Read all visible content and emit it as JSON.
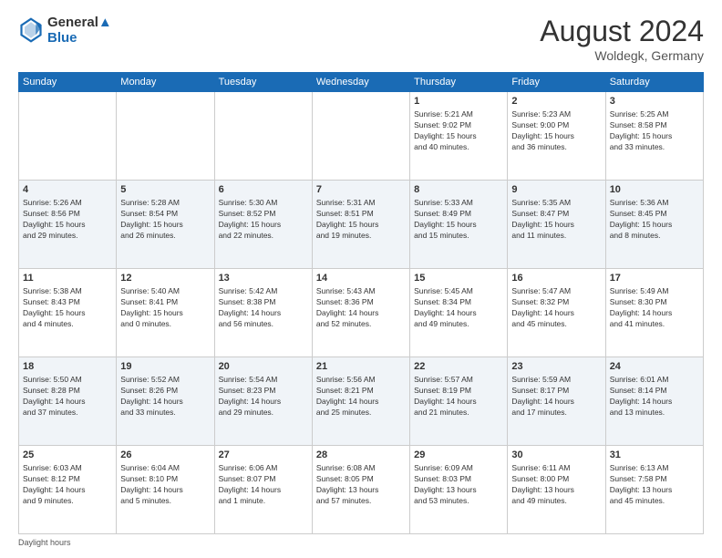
{
  "header": {
    "logo_line1": "General",
    "logo_line2": "Blue",
    "month_year": "August 2024",
    "location": "Woldegk, Germany"
  },
  "days_of_week": [
    "Sunday",
    "Monday",
    "Tuesday",
    "Wednesday",
    "Thursday",
    "Friday",
    "Saturday"
  ],
  "weeks": [
    [
      {
        "day": "",
        "info": ""
      },
      {
        "day": "",
        "info": ""
      },
      {
        "day": "",
        "info": ""
      },
      {
        "day": "",
        "info": ""
      },
      {
        "day": "1",
        "info": "Sunrise: 5:21 AM\nSunset: 9:02 PM\nDaylight: 15 hours\nand 40 minutes."
      },
      {
        "day": "2",
        "info": "Sunrise: 5:23 AM\nSunset: 9:00 PM\nDaylight: 15 hours\nand 36 minutes."
      },
      {
        "day": "3",
        "info": "Sunrise: 5:25 AM\nSunset: 8:58 PM\nDaylight: 15 hours\nand 33 minutes."
      }
    ],
    [
      {
        "day": "4",
        "info": "Sunrise: 5:26 AM\nSunset: 8:56 PM\nDaylight: 15 hours\nand 29 minutes."
      },
      {
        "day": "5",
        "info": "Sunrise: 5:28 AM\nSunset: 8:54 PM\nDaylight: 15 hours\nand 26 minutes."
      },
      {
        "day": "6",
        "info": "Sunrise: 5:30 AM\nSunset: 8:52 PM\nDaylight: 15 hours\nand 22 minutes."
      },
      {
        "day": "7",
        "info": "Sunrise: 5:31 AM\nSunset: 8:51 PM\nDaylight: 15 hours\nand 19 minutes."
      },
      {
        "day": "8",
        "info": "Sunrise: 5:33 AM\nSunset: 8:49 PM\nDaylight: 15 hours\nand 15 minutes."
      },
      {
        "day": "9",
        "info": "Sunrise: 5:35 AM\nSunset: 8:47 PM\nDaylight: 15 hours\nand 11 minutes."
      },
      {
        "day": "10",
        "info": "Sunrise: 5:36 AM\nSunset: 8:45 PM\nDaylight: 15 hours\nand 8 minutes."
      }
    ],
    [
      {
        "day": "11",
        "info": "Sunrise: 5:38 AM\nSunset: 8:43 PM\nDaylight: 15 hours\nand 4 minutes."
      },
      {
        "day": "12",
        "info": "Sunrise: 5:40 AM\nSunset: 8:41 PM\nDaylight: 15 hours\nand 0 minutes."
      },
      {
        "day": "13",
        "info": "Sunrise: 5:42 AM\nSunset: 8:38 PM\nDaylight: 14 hours\nand 56 minutes."
      },
      {
        "day": "14",
        "info": "Sunrise: 5:43 AM\nSunset: 8:36 PM\nDaylight: 14 hours\nand 52 minutes."
      },
      {
        "day": "15",
        "info": "Sunrise: 5:45 AM\nSunset: 8:34 PM\nDaylight: 14 hours\nand 49 minutes."
      },
      {
        "day": "16",
        "info": "Sunrise: 5:47 AM\nSunset: 8:32 PM\nDaylight: 14 hours\nand 45 minutes."
      },
      {
        "day": "17",
        "info": "Sunrise: 5:49 AM\nSunset: 8:30 PM\nDaylight: 14 hours\nand 41 minutes."
      }
    ],
    [
      {
        "day": "18",
        "info": "Sunrise: 5:50 AM\nSunset: 8:28 PM\nDaylight: 14 hours\nand 37 minutes."
      },
      {
        "day": "19",
        "info": "Sunrise: 5:52 AM\nSunset: 8:26 PM\nDaylight: 14 hours\nand 33 minutes."
      },
      {
        "day": "20",
        "info": "Sunrise: 5:54 AM\nSunset: 8:23 PM\nDaylight: 14 hours\nand 29 minutes."
      },
      {
        "day": "21",
        "info": "Sunrise: 5:56 AM\nSunset: 8:21 PM\nDaylight: 14 hours\nand 25 minutes."
      },
      {
        "day": "22",
        "info": "Sunrise: 5:57 AM\nSunset: 8:19 PM\nDaylight: 14 hours\nand 21 minutes."
      },
      {
        "day": "23",
        "info": "Sunrise: 5:59 AM\nSunset: 8:17 PM\nDaylight: 14 hours\nand 17 minutes."
      },
      {
        "day": "24",
        "info": "Sunrise: 6:01 AM\nSunset: 8:14 PM\nDaylight: 14 hours\nand 13 minutes."
      }
    ],
    [
      {
        "day": "25",
        "info": "Sunrise: 6:03 AM\nSunset: 8:12 PM\nDaylight: 14 hours\nand 9 minutes."
      },
      {
        "day": "26",
        "info": "Sunrise: 6:04 AM\nSunset: 8:10 PM\nDaylight: 14 hours\nand 5 minutes."
      },
      {
        "day": "27",
        "info": "Sunrise: 6:06 AM\nSunset: 8:07 PM\nDaylight: 14 hours\nand 1 minute."
      },
      {
        "day": "28",
        "info": "Sunrise: 6:08 AM\nSunset: 8:05 PM\nDaylight: 13 hours\nand 57 minutes."
      },
      {
        "day": "29",
        "info": "Sunrise: 6:09 AM\nSunset: 8:03 PM\nDaylight: 13 hours\nand 53 minutes."
      },
      {
        "day": "30",
        "info": "Sunrise: 6:11 AM\nSunset: 8:00 PM\nDaylight: 13 hours\nand 49 minutes."
      },
      {
        "day": "31",
        "info": "Sunrise: 6:13 AM\nSunset: 7:58 PM\nDaylight: 13 hours\nand 45 minutes."
      }
    ]
  ],
  "footer": {
    "note": "Daylight hours"
  }
}
